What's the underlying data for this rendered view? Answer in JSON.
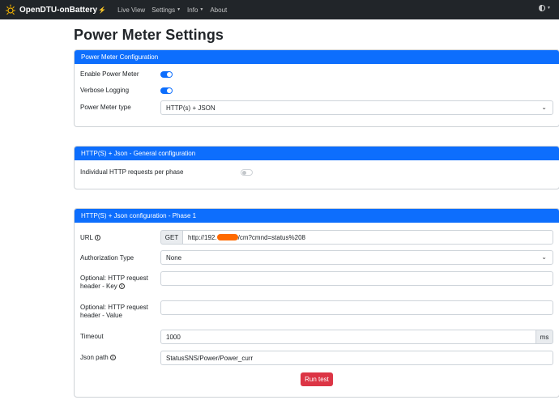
{
  "navbar": {
    "brand": "OpenDTU-onBattery",
    "items": [
      {
        "label": "Live View",
        "dropdown": false
      },
      {
        "label": "Settings",
        "dropdown": true
      },
      {
        "label": "Info",
        "dropdown": true
      },
      {
        "label": "About",
        "dropdown": false
      }
    ]
  },
  "page": {
    "title": "Power Meter Settings"
  },
  "config_card": {
    "header": "Power Meter Configuration",
    "enable_label": "Enable Power Meter",
    "enable_on": true,
    "verbose_label": "Verbose Logging",
    "verbose_on": true,
    "type_label": "Power Meter type",
    "type_value": "HTTP(s) + JSON"
  },
  "general_card": {
    "header": "HTTP(S) + Json - General configuration",
    "individual_label": "Individual HTTP requests per phase",
    "individual_on": false
  },
  "phase_card": {
    "header": "HTTP(S) + Json configuration - Phase 1",
    "url_label": "URL",
    "url_method": "GET",
    "url_prefix": "http://192.",
    "url_suffix": "/cm?cmnd=status%208",
    "auth_label": "Authorization Type",
    "auth_value": "None",
    "key_label_1": "Optional: HTTP request",
    "key_label_2": "header - Key",
    "key_value": "",
    "value_label_1": "Optional: HTTP request",
    "value_label_2": "header - Value",
    "value_value": "",
    "timeout_label": "Timeout",
    "timeout_value": "1000",
    "timeout_unit": "ms",
    "jsonpath_label": "Json path",
    "jsonpath_value": "StatusSNS/Power/Power_curr",
    "run_test": "Run test"
  },
  "icons": [
    "sun-logo-icon",
    "bolt-icon",
    "theme-icon",
    "info-icon",
    "chevron-down-icon"
  ],
  "colors": {
    "primary": "#0d6efd",
    "danger": "#dc3545",
    "navbar": "#212529"
  }
}
